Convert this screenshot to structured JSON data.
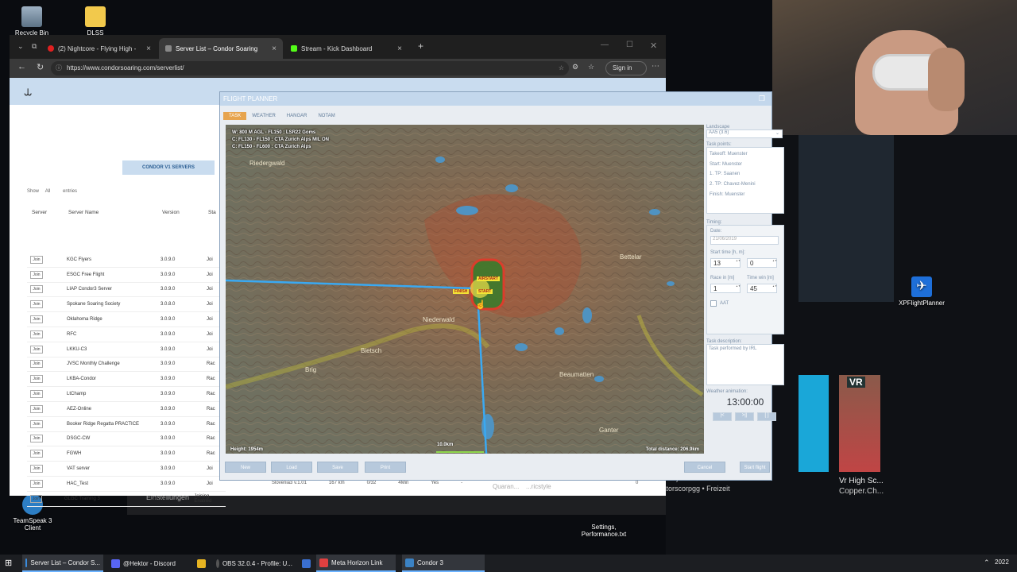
{
  "desktop": {
    "icons": [
      {
        "label": "Recycle Bin"
      },
      {
        "label": "DLSS"
      },
      {
        "label": "XPFlightPlanner"
      },
      {
        "label": "TeamSpeak 3 Client"
      },
      {
        "label": "Settings,\nPerformance.txt"
      }
    ],
    "bg_texts": {
      "einstellungen": "Einstellungen",
      "tycoon": "...ner Tycoon - The Vola...",
      "freizeit": "...atorscorpgg • Freizeit",
      "vr_title": "Vr High Sc...",
      "vr_sub": "Copper.Ch...",
      "vr_badge": "VR"
    }
  },
  "browser": {
    "tabs": [
      {
        "label": "(2) Nightcore - Flying High -",
        "active": false,
        "icon_color": "#e02020"
      },
      {
        "label": "Server List – Condor Soaring",
        "active": true,
        "icon_color": "#888888"
      },
      {
        "label": "Stream - Kick Dashboard",
        "active": false,
        "icon_color": "#53fc18"
      }
    ],
    "url": "https://www.condorsoaring.com/serverlist/",
    "sign_in": "Sign in",
    "page": {
      "servers_button": "CONDOR V1 SERVERS",
      "show_label": "Show",
      "show_value": "All",
      "entries_label": "entries",
      "headers": [
        "Server",
        "Server Name",
        "Version",
        "Sta"
      ],
      "join_label": "Join",
      "rows": [
        {
          "name": "KGC Flyers",
          "version": "3.0.9.0",
          "status": "Joi"
        },
        {
          "name": "ESGC Free Flight",
          "version": "3.0.9.0",
          "status": "Joi"
        },
        {
          "name": "LIAP Condor3 Server",
          "version": "3.0.9.0",
          "status": "Joi"
        },
        {
          "name": "Spokane Soaring Society",
          "version": "3.0.8.0",
          "status": "Joi"
        },
        {
          "name": "Oklahoma Ridge",
          "version": "3.0.9.0",
          "status": "Joi"
        },
        {
          "name": "RFC",
          "version": "3.0.9.0",
          "status": "Joi"
        },
        {
          "name": "LKKU-C3",
          "version": "3.0.9.0",
          "status": "Joi"
        },
        {
          "name": "JVSC Monthly Challenge",
          "version": "3.0.9.0",
          "status": "Rac"
        },
        {
          "name": "LKBA-Condor",
          "version": "3.0.9.0",
          "status": "Rac"
        },
        {
          "name": "LtChamp",
          "version": "3.0.9.0",
          "status": "Rac"
        },
        {
          "name": "AEZ-Online",
          "version": "3.0.9.0",
          "status": "Rac"
        },
        {
          "name": "Booker Ridge Regatta PRACTICE",
          "version": "3.0.9.0",
          "status": "Rac"
        },
        {
          "name": "DSGC-CW",
          "version": "3.0.9.0",
          "status": "Rac"
        },
        {
          "name": "FGWH",
          "version": "3.0.9.0",
          "status": "Rac"
        },
        {
          "name": "VAT server",
          "version": "3.0.9.0",
          "status": "Joi"
        },
        {
          "name": "HAC_Test",
          "version": "3.0.9.0",
          "status": "Joi"
        },
        {
          "name": "GLGC Training 3",
          "version": "3.0.9.0",
          "status": "Joining Enabled"
        }
      ],
      "last_row_extra": {
        "landscape": "Slovenia3 v.1.01",
        "distance": "167 km",
        "players": "0/32",
        "time": "4Min",
        "locked": "Yes",
        "dash": "-",
        "zero": "0"
      },
      "bg_text_1": "Quaran...",
      "bg_text_2": "...ricstyle"
    }
  },
  "planner": {
    "title": "FLIGHT PLANNER",
    "tabs": [
      "TASK",
      "WEATHER",
      "HANGAR",
      "NOTAM"
    ],
    "map_info": [
      "W: 800 M AGL - FL150 : LSR22 Goms",
      "C: FL130 - FL150 : CTA Zurich Alps MIL ON",
      "C: FL150 - FL600 : CTA Zurich Alps"
    ],
    "height": "Height: 1954m",
    "scale": "10.0km",
    "total_distance": "Total distance: 206.9km",
    "labels": {
      "airstart": "AIRSTART",
      "finish": "FINISH",
      "start": "START"
    },
    "place_names": [
      "Riedergwald",
      "Bettelar",
      "Bietsch",
      "Brig",
      "Niederwald",
      "Beaumatten",
      "Ganter"
    ],
    "buttons": {
      "new": "New",
      "load": "Load",
      "save": "Save",
      "print": "Print",
      "cancel": "Cancel",
      "start_flight": "Start flight"
    },
    "side": {
      "landscape_label": "Landscape",
      "landscape_value": "AA5 (3.6)",
      "taskpoints_label": "Task points:",
      "taskpoints": [
        "Takeoff: Muenster",
        "Start: Muenster",
        "1. TP: Saanen",
        "2. TP: Chavez-Menini",
        "Finish: Muenster"
      ],
      "timing_label": "Timing:",
      "date_label": "Date:",
      "date_value": "21/06/2019",
      "start_time_label": "Start time [h, m]:",
      "start_h": "13",
      "start_m": "0",
      "race_label": "Race in [m]",
      "race_value": "1",
      "window_label": "Time win [m]",
      "window_value": "45",
      "aat_label": "AAT",
      "desc_label": "Task description:",
      "desc_value": "Task performed by IRL",
      "weather_anim_label": "Weather animation:",
      "clock": "13:00:00",
      "anim_buttons": [
        "|<",
        ">||",
        "[ ]"
      ]
    }
  },
  "taskbar": {
    "items": [
      {
        "label": "Server List – Condor S...",
        "color": "#3a8bdc"
      },
      {
        "label": "@Hektor - Discord",
        "color": "#5865f2"
      },
      {
        "label": "",
        "color": "#e6b422"
      },
      {
        "label": "OBS 32.0.4 - Profile: U...",
        "color": "#555555"
      },
      {
        "label": "",
        "color": "#3a6fd0"
      },
      {
        "label": "Meta Horizon Link",
        "color": "#e04040"
      },
      {
        "label": "Condor 3",
        "color": "#3b82c4"
      }
    ],
    "clock": "2022"
  }
}
